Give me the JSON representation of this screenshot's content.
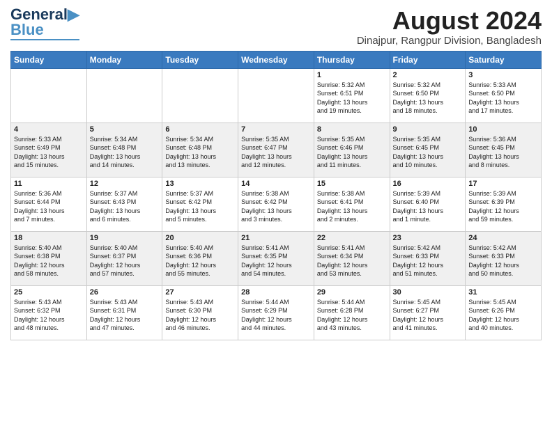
{
  "header": {
    "logo_line1": "General",
    "logo_line2": "Blue",
    "month_title": "August 2024",
    "subtitle": "Dinajpur, Rangpur Division, Bangladesh"
  },
  "weekdays": [
    "Sunday",
    "Monday",
    "Tuesday",
    "Wednesday",
    "Thursday",
    "Friday",
    "Saturday"
  ],
  "weeks": [
    [
      {
        "day": "",
        "text": ""
      },
      {
        "day": "",
        "text": ""
      },
      {
        "day": "",
        "text": ""
      },
      {
        "day": "",
        "text": ""
      },
      {
        "day": "1",
        "text": "Sunrise: 5:32 AM\nSunset: 6:51 PM\nDaylight: 13 hours\nand 19 minutes."
      },
      {
        "day": "2",
        "text": "Sunrise: 5:32 AM\nSunset: 6:50 PM\nDaylight: 13 hours\nand 18 minutes."
      },
      {
        "day": "3",
        "text": "Sunrise: 5:33 AM\nSunset: 6:50 PM\nDaylight: 13 hours\nand 17 minutes."
      }
    ],
    [
      {
        "day": "4",
        "text": "Sunrise: 5:33 AM\nSunset: 6:49 PM\nDaylight: 13 hours\nand 15 minutes."
      },
      {
        "day": "5",
        "text": "Sunrise: 5:34 AM\nSunset: 6:48 PM\nDaylight: 13 hours\nand 14 minutes."
      },
      {
        "day": "6",
        "text": "Sunrise: 5:34 AM\nSunset: 6:48 PM\nDaylight: 13 hours\nand 13 minutes."
      },
      {
        "day": "7",
        "text": "Sunrise: 5:35 AM\nSunset: 6:47 PM\nDaylight: 13 hours\nand 12 minutes."
      },
      {
        "day": "8",
        "text": "Sunrise: 5:35 AM\nSunset: 6:46 PM\nDaylight: 13 hours\nand 11 minutes."
      },
      {
        "day": "9",
        "text": "Sunrise: 5:35 AM\nSunset: 6:45 PM\nDaylight: 13 hours\nand 10 minutes."
      },
      {
        "day": "10",
        "text": "Sunrise: 5:36 AM\nSunset: 6:45 PM\nDaylight: 13 hours\nand 8 minutes."
      }
    ],
    [
      {
        "day": "11",
        "text": "Sunrise: 5:36 AM\nSunset: 6:44 PM\nDaylight: 13 hours\nand 7 minutes."
      },
      {
        "day": "12",
        "text": "Sunrise: 5:37 AM\nSunset: 6:43 PM\nDaylight: 13 hours\nand 6 minutes."
      },
      {
        "day": "13",
        "text": "Sunrise: 5:37 AM\nSunset: 6:42 PM\nDaylight: 13 hours\nand 5 minutes."
      },
      {
        "day": "14",
        "text": "Sunrise: 5:38 AM\nSunset: 6:42 PM\nDaylight: 13 hours\nand 3 minutes."
      },
      {
        "day": "15",
        "text": "Sunrise: 5:38 AM\nSunset: 6:41 PM\nDaylight: 13 hours\nand 2 minutes."
      },
      {
        "day": "16",
        "text": "Sunrise: 5:39 AM\nSunset: 6:40 PM\nDaylight: 13 hours\nand 1 minute."
      },
      {
        "day": "17",
        "text": "Sunrise: 5:39 AM\nSunset: 6:39 PM\nDaylight: 12 hours\nand 59 minutes."
      }
    ],
    [
      {
        "day": "18",
        "text": "Sunrise: 5:40 AM\nSunset: 6:38 PM\nDaylight: 12 hours\nand 58 minutes."
      },
      {
        "day": "19",
        "text": "Sunrise: 5:40 AM\nSunset: 6:37 PM\nDaylight: 12 hours\nand 57 minutes."
      },
      {
        "day": "20",
        "text": "Sunrise: 5:40 AM\nSunset: 6:36 PM\nDaylight: 12 hours\nand 55 minutes."
      },
      {
        "day": "21",
        "text": "Sunrise: 5:41 AM\nSunset: 6:35 PM\nDaylight: 12 hours\nand 54 minutes."
      },
      {
        "day": "22",
        "text": "Sunrise: 5:41 AM\nSunset: 6:34 PM\nDaylight: 12 hours\nand 53 minutes."
      },
      {
        "day": "23",
        "text": "Sunrise: 5:42 AM\nSunset: 6:33 PM\nDaylight: 12 hours\nand 51 minutes."
      },
      {
        "day": "24",
        "text": "Sunrise: 5:42 AM\nSunset: 6:33 PM\nDaylight: 12 hours\nand 50 minutes."
      }
    ],
    [
      {
        "day": "25",
        "text": "Sunrise: 5:43 AM\nSunset: 6:32 PM\nDaylight: 12 hours\nand 48 minutes."
      },
      {
        "day": "26",
        "text": "Sunrise: 5:43 AM\nSunset: 6:31 PM\nDaylight: 12 hours\nand 47 minutes."
      },
      {
        "day": "27",
        "text": "Sunrise: 5:43 AM\nSunset: 6:30 PM\nDaylight: 12 hours\nand 46 minutes."
      },
      {
        "day": "28",
        "text": "Sunrise: 5:44 AM\nSunset: 6:29 PM\nDaylight: 12 hours\nand 44 minutes."
      },
      {
        "day": "29",
        "text": "Sunrise: 5:44 AM\nSunset: 6:28 PM\nDaylight: 12 hours\nand 43 minutes."
      },
      {
        "day": "30",
        "text": "Sunrise: 5:45 AM\nSunset: 6:27 PM\nDaylight: 12 hours\nand 41 minutes."
      },
      {
        "day": "31",
        "text": "Sunrise: 5:45 AM\nSunset: 6:26 PM\nDaylight: 12 hours\nand 40 minutes."
      }
    ]
  ]
}
